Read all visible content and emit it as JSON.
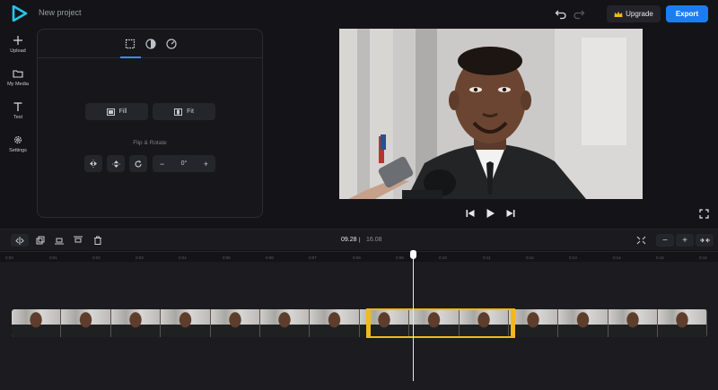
{
  "app": {
    "project_title": "New project"
  },
  "header": {
    "upgrade_label": "Upgrade",
    "export_label": "Export",
    "colors": {
      "export": "#1d7cf2",
      "crown": "#f2b91a"
    }
  },
  "sidebar": {
    "items": [
      {
        "label": "Upload",
        "icon": "plus-icon"
      },
      {
        "label": "My Media",
        "icon": "folder-icon"
      },
      {
        "label": "Text",
        "icon": "text-icon"
      },
      {
        "label": "Settings",
        "icon": "gear-icon"
      }
    ]
  },
  "panel": {
    "tabs": [
      {
        "icon": "crop-icon",
        "active": true
      },
      {
        "icon": "contrast-icon"
      },
      {
        "icon": "speed-icon"
      }
    ],
    "fill_label": "Fill",
    "fit_label": "Fit",
    "flip_rotate_label": "Flip & Rotate",
    "rotation_value": "0°",
    "minus_label": "−",
    "plus_label": "+"
  },
  "timeline": {
    "current_time": "09.28",
    "total_time": "16.08",
    "zoom_minus": "−",
    "zoom_plus": "+",
    "ruler_ticks": [
      "0:00",
      "0:01",
      "0:02",
      "0:03",
      "0:04",
      "0:05",
      "0:06",
      "0:07",
      "0:08",
      "0:09",
      "0:10",
      "0:11",
      "0:12",
      "0:13",
      "0:14",
      "0:15",
      "0:16"
    ],
    "selection_color": "#f2b91a"
  }
}
